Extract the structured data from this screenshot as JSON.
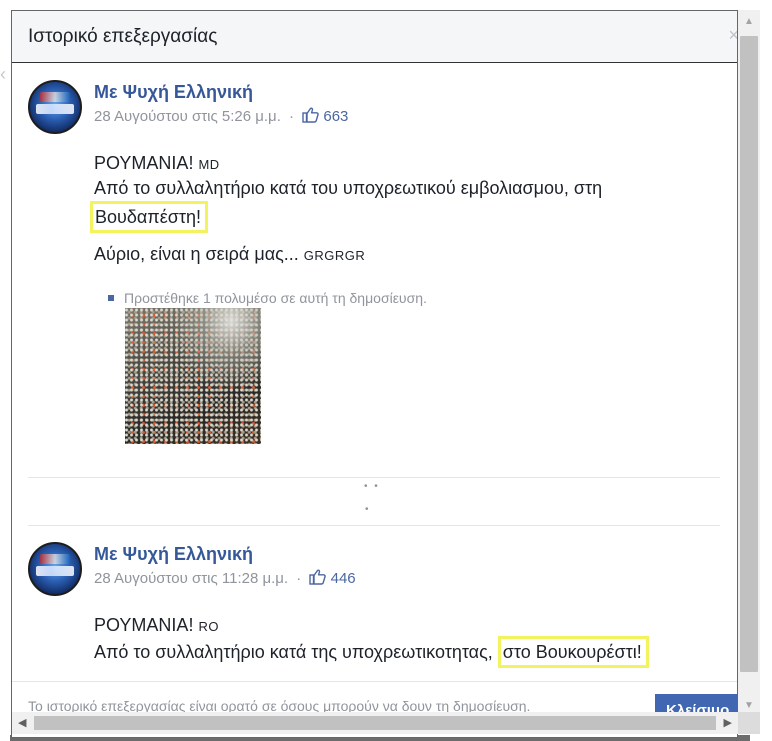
{
  "dialog": {
    "title": "Ιστορικό επεξεργασίας",
    "close_glyph": "×"
  },
  "posts": [
    {
      "author": "Με Ψυχή Ελληνική",
      "timestamp": "28 Αυγούστου στις 5:26 μ.μ.",
      "separator": "·",
      "like_count": "663",
      "line1_text": "ΡΟΥΜΑΝΙΑ!",
      "line1_tag": "MD",
      "line2_text": "Από το συλλαλητήριο κατά του υποχρεωτικού εμβολιασμου, στη",
      "line3_text": "Βουδαπέστη!",
      "line4_text": "Αύριο, είναι η σειρά μας...",
      "line4_tag": "GRGRGR",
      "media_note": "Προστέθηκε 1 πολυμέσο σε αυτή τη δημοσίευση."
    },
    {
      "author": "Με Ψυχή Ελληνική",
      "timestamp": "28 Αυγούστου στις 11:28 μ.μ.",
      "separator": "·",
      "like_count": "446",
      "line1_text": "ΡΟΥΜΑΝΙΑ!",
      "line1_tag": "RO",
      "line2_text": "Από το συλλαλητήριο κατά της υποχρεωτικοτητας,",
      "line2_highlight": "στο Βουκουρέστι!"
    }
  ],
  "collapsed_dots": {
    "top": "• •",
    "bottom": "•"
  },
  "footer": {
    "text": "Το ιστορικό επεξεργασίας είναι ορατό σε όσους μπορούν να δουν τη δημοσίευση.",
    "close_label": "Κλείσιμο"
  },
  "scrollbars": {
    "up": "▲",
    "down": "▼",
    "left": "◀",
    "right": "▶"
  },
  "colors": {
    "link_blue": "#365899",
    "highlight_yellow": "#f3f35f",
    "button_blue": "#4267b2"
  }
}
